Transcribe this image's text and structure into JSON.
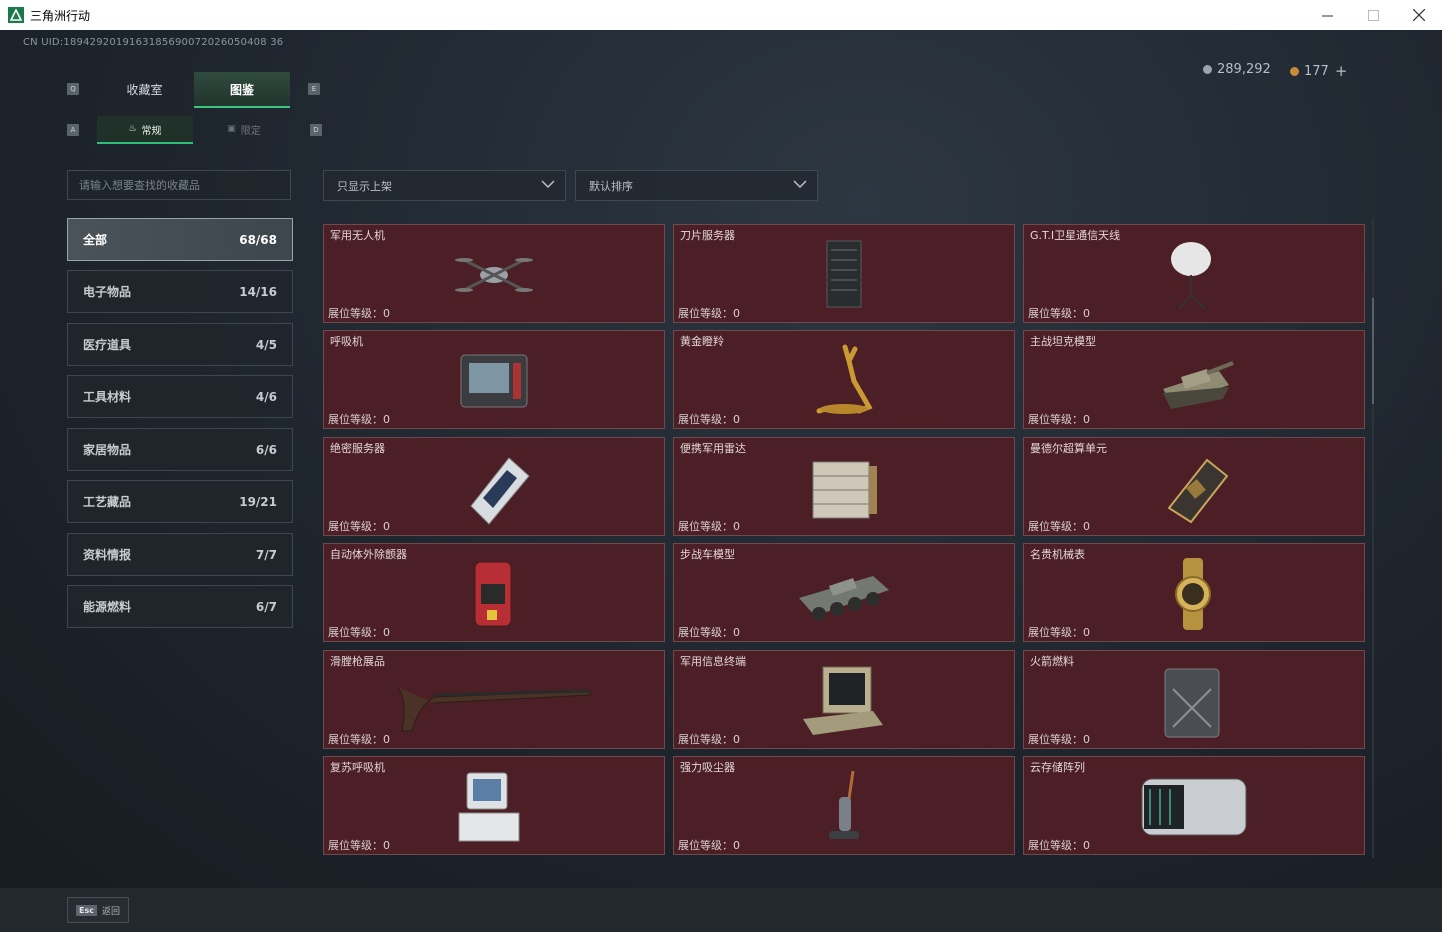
{
  "window": {
    "title": "三角洲行动",
    "controls": [
      "minimize",
      "maximize",
      "close"
    ]
  },
  "header": {
    "uid": "CN UID:1894292019163185690072026050408 36",
    "currency_silver": "289,292",
    "currency_gold": "177",
    "add_label": "+"
  },
  "key_hints": {
    "prev_tab": "Q",
    "next_tab": "E",
    "prev_sub": "A",
    "next_sub": "D"
  },
  "tabs": [
    {
      "label": "收藏室",
      "active": false
    },
    {
      "label": "图鉴",
      "active": true
    }
  ],
  "subtabs": [
    {
      "label": "常规",
      "icon": "flame-icon",
      "active": true
    },
    {
      "label": "限定",
      "icon": "limited-icon",
      "active": false
    }
  ],
  "search": {
    "placeholder": "请输入想要查找的收藏品"
  },
  "filters": {
    "shelf": {
      "value": "只显示上架"
    },
    "sort": {
      "value": "默认排序"
    }
  },
  "categories": [
    {
      "label": "全部",
      "count": "68/68",
      "active": true
    },
    {
      "label": "电子物品",
      "count": "14/16"
    },
    {
      "label": "医疗道具",
      "count": "4/5"
    },
    {
      "label": "工具材料",
      "count": "4/6"
    },
    {
      "label": "家居物品",
      "count": "6/6"
    },
    {
      "label": "工艺藏品",
      "count": "19/21"
    },
    {
      "label": "资料情报",
      "count": "7/7"
    },
    {
      "label": "能源燃料",
      "count": "6/7"
    }
  ],
  "level_prefix": "展位等级：",
  "items": [
    {
      "name": "军用无人机",
      "level": "0",
      "icon": "drone-icon"
    },
    {
      "name": "刀片服务器",
      "level": "0",
      "icon": "server-icon"
    },
    {
      "name": "G.T.I卫星通信天线",
      "level": "0",
      "icon": "satellite-dish-icon"
    },
    {
      "name": "呼吸机",
      "level": "0",
      "icon": "ventilator-icon"
    },
    {
      "name": "黄金瞪羚",
      "level": "0",
      "icon": "gold-gazelle-icon"
    },
    {
      "name": "主战坦克模型",
      "level": "0",
      "icon": "tank-icon"
    },
    {
      "name": "绝密服务器",
      "level": "0",
      "icon": "secret-server-icon"
    },
    {
      "name": "便携军用雷达",
      "level": "0",
      "icon": "radar-icon"
    },
    {
      "name": "曼德尔超算单元",
      "level": "0",
      "icon": "compute-unit-icon"
    },
    {
      "name": "自动体外除颤器",
      "level": "0",
      "icon": "defibrillator-icon"
    },
    {
      "name": "步战车模型",
      "level": "0",
      "icon": "ifv-icon"
    },
    {
      "name": "名贵机械表",
      "level": "0",
      "icon": "watch-icon"
    },
    {
      "name": "滑膛枪展品",
      "level": "0",
      "icon": "musket-icon"
    },
    {
      "name": "军用信息终端",
      "level": "0",
      "icon": "terminal-icon"
    },
    {
      "name": "火箭燃料",
      "level": "0",
      "icon": "fuel-can-icon"
    },
    {
      "name": "复苏呼吸机",
      "level": "0",
      "icon": "resus-ventilator-icon"
    },
    {
      "name": "强力吸尘器",
      "level": "0",
      "icon": "vacuum-icon"
    },
    {
      "name": "云存储阵列",
      "level": "0",
      "icon": "storage-array-icon"
    }
  ],
  "footer": {
    "esc_key": "Esc",
    "back_label": "返回"
  },
  "colors": {
    "accent": "#39c783",
    "card_bg": "#4b1f25",
    "card_border": "#6e4a4f"
  }
}
